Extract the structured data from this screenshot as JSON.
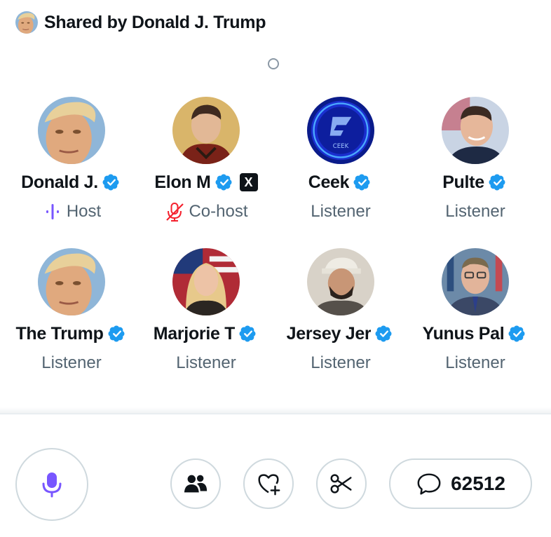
{
  "header": {
    "shared_by": "Shared by Donald J. Trump"
  },
  "participants": [
    {
      "name": "Donald J.",
      "role": "Host",
      "role_icon": "host-wave-icon",
      "verified": true
    },
    {
      "name": "Elon M",
      "role": "Co-host",
      "role_icon": "mic-muted-icon",
      "verified": true,
      "affiliate": "X"
    },
    {
      "name": "Ceek",
      "role": "Listener",
      "verified": true
    },
    {
      "name": "Pulte",
      "role": "Listener",
      "verified": true
    },
    {
      "name": "The Trump",
      "role": "Listener",
      "verified": true
    },
    {
      "name": "Marjorie T",
      "role": "Listener",
      "verified": true
    },
    {
      "name": "Jersey Jer",
      "role": "Listener",
      "verified": true
    },
    {
      "name": "Yunus Pal",
      "role": "Listener",
      "verified": true
    }
  ],
  "controls": {
    "mic_icon": "microphone-icon",
    "people_icon": "people-icon",
    "heart_icon": "heart-plus-icon",
    "clip_icon": "scissors-icon",
    "comment_icon": "speech-bubble-icon",
    "comments_count": "62512"
  },
  "colors": {
    "verified": "#1d9bf0",
    "host_purple": "#7856ff",
    "muted_red": "#f4212e",
    "secondary_text": "#536471",
    "border": "#cfd9de"
  }
}
